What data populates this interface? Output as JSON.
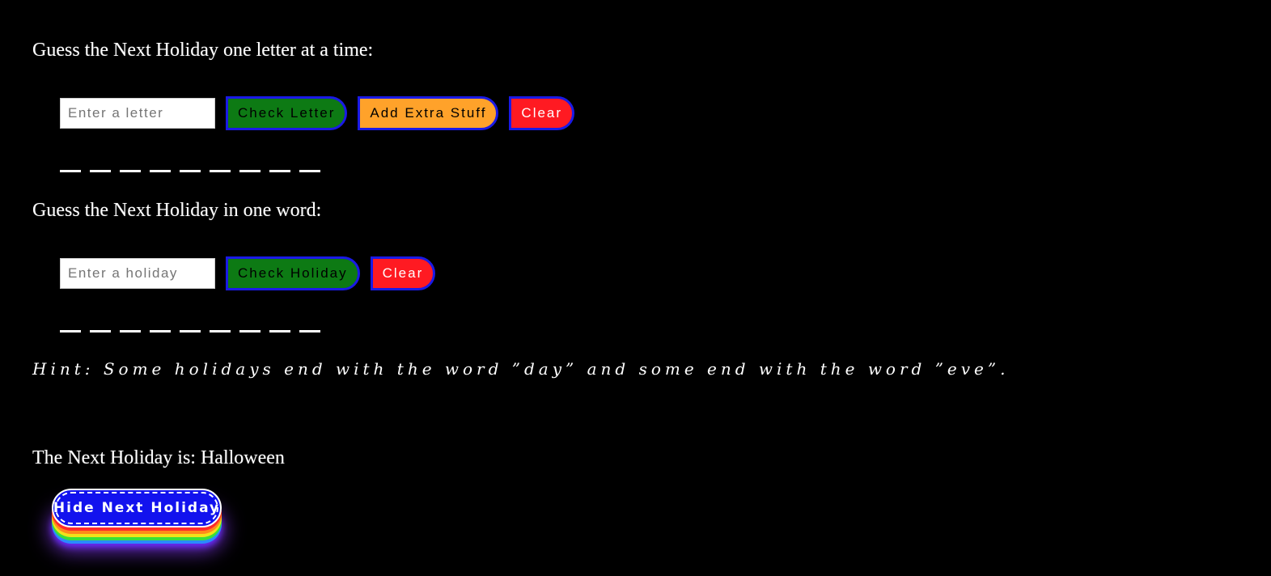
{
  "letter_section": {
    "heading": "Guess the Next Holiday one letter at a time:",
    "input_placeholder": "Enter a letter",
    "input_value": "",
    "check_button": "Check Letter",
    "extra_button": "Add Extra Stuff",
    "clear_button": "Clear",
    "blanks": [
      "",
      "",
      "",
      "",
      "",
      "",
      "",
      "",
      ""
    ]
  },
  "word_section": {
    "heading": "Guess the Next Holiday in one word:",
    "input_placeholder": "Enter a holiday",
    "input_value": "",
    "check_button": "Check Holiday",
    "clear_button": "Clear",
    "blanks": [
      "",
      "",
      "",
      "",
      "",
      "",
      "",
      "",
      ""
    ]
  },
  "hint": "Hint: Some holidays end with the word ”day” and some end with the word ”eve”.",
  "answer": {
    "label": "The Next Holiday is: Halloween"
  },
  "hide_button": "Hide Next Holiday",
  "colors": {
    "background": "#000000",
    "check_button": "#0d7a14",
    "extra_button": "#ffa22a",
    "clear_button": "#ff1a22",
    "button_border": "#1a1ae6",
    "hide_button": "#1212ee"
  },
  "icons": []
}
